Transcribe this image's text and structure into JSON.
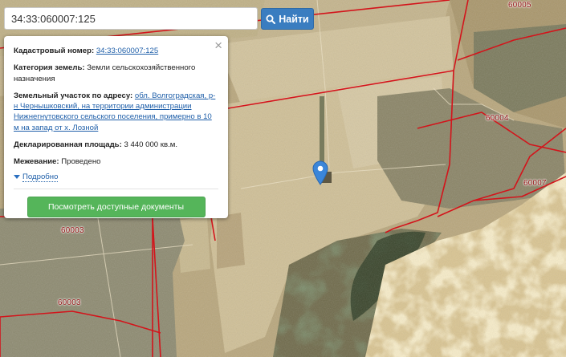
{
  "search": {
    "value": "34:33:060007:125",
    "button_label": "Найти"
  },
  "popup": {
    "cadastral_label": "Кадастровый номер:",
    "cadastral_value": "34:33:060007:125",
    "category_label": "Категория земель:",
    "category_value": "Земли сельскохозяйственного назначения",
    "address_label": "Земельный участок по адресу:",
    "address_value": "обл. Волгоградская, р-н Чернышковский, на территории администрации Нижнегнутовского сельского поселения, примерно в 10 м на запад от х. Лозной",
    "area_label": "Декларированная площадь:",
    "area_value": "3 440 000 кв.м.",
    "survey_label": "Межевание:",
    "survey_value": "Проведено",
    "more_label": "Подробно",
    "docs_button": "Посмотреть доступные документы",
    "close_symbol": "×"
  },
  "map_labels": {
    "top_right": "60005",
    "right_mid": "60004",
    "right_low": "60007",
    "left_a": "60003",
    "left_b": "60003"
  },
  "colors": {
    "boundary": "#d3141b",
    "label": "#8e0b0b",
    "search_button": "#3a7dc0",
    "docs_button": "#55b55a",
    "marker": "#3b86d9"
  },
  "icons": {
    "search": "search-icon",
    "marker": "map-marker-icon",
    "close": "close-icon",
    "expand": "triangle-down-icon"
  }
}
